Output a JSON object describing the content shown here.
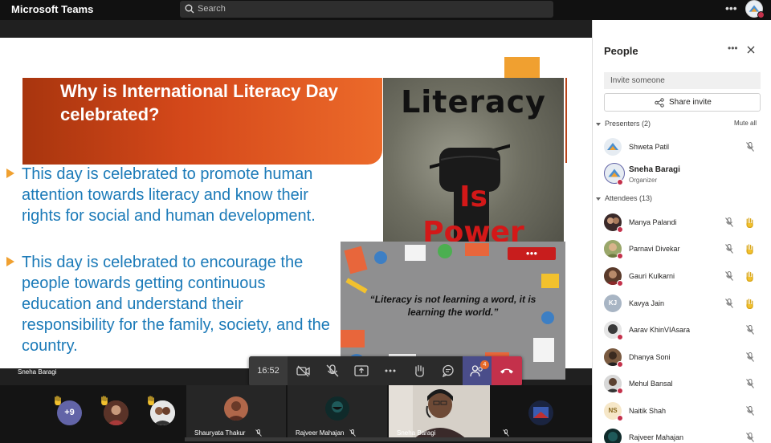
{
  "app": {
    "title": "Microsoft Teams"
  },
  "search": {
    "placeholder": "Search"
  },
  "slide": {
    "title": "Why is International Literacy Day celebrated?",
    "bullets": [
      "This day is celebrated to promote human attention towards literacy and know their rights for social and human development.",
      "This day is celebrated to encourage the people towards getting continuous education and understand their responsibility for the family, society, and the country."
    ],
    "image_words": {
      "top": "Literacy",
      "middle": "Is",
      "bottom": "Power"
    },
    "quote": "“Literacy is not learning a word, it is learning the world.”"
  },
  "presenter_label": "Sneha Baragi",
  "meeting_controls": {
    "timer": "16:52",
    "people_badge": "4",
    "icons": [
      "video-off-icon",
      "mic-off-icon",
      "share-screen-icon",
      "more-icon",
      "raise-hand-icon",
      "chat-icon",
      "people-icon",
      "hang-up-icon"
    ]
  },
  "video_strip": {
    "overflow_count": "+9",
    "tiles": [
      {
        "name": "Shauryata Thakur"
      },
      {
        "name": "Rajveer Mahajan"
      },
      {
        "name": "Sneha Baragi"
      }
    ]
  },
  "people_panel": {
    "title": "People",
    "invite_placeholder": "Invite someone",
    "share_invite_label": "Share invite",
    "presenters_header": "Presenters (2)",
    "mute_all_label": "Mute all",
    "presenters": [
      {
        "name": "Shweta Patil",
        "role": ""
      },
      {
        "name": "Sneha Baragi",
        "role": "Organizer"
      }
    ],
    "attendees_header": "Attendees (13)",
    "attendees": [
      {
        "name": "Manya Palandi",
        "hand_raised": true
      },
      {
        "name": "Parnavi Divekar",
        "hand_raised": true
      },
      {
        "name": "Gauri Kulkarni",
        "hand_raised": true
      },
      {
        "name": "Kavya Jain",
        "initials": "KJ",
        "hand_raised": true
      },
      {
        "name": "Aarav KhinVIAsara",
        "hand_raised": false
      },
      {
        "name": "Dhanya Soni",
        "hand_raised": false
      },
      {
        "name": "Mehul Bansal",
        "hand_raised": false
      },
      {
        "name": "Naitik Shah",
        "initials": "NS",
        "hand_raised": false
      }
    ],
    "partial_attendee": "Rajveer Mahajan"
  },
  "colors": {
    "teams_purple": "#6264a7",
    "hangup_red": "#c4314b",
    "bullet_blue": "#1b7ab8",
    "banner_orange": "#d4481a",
    "hand_yellow": "#f2c12e"
  }
}
